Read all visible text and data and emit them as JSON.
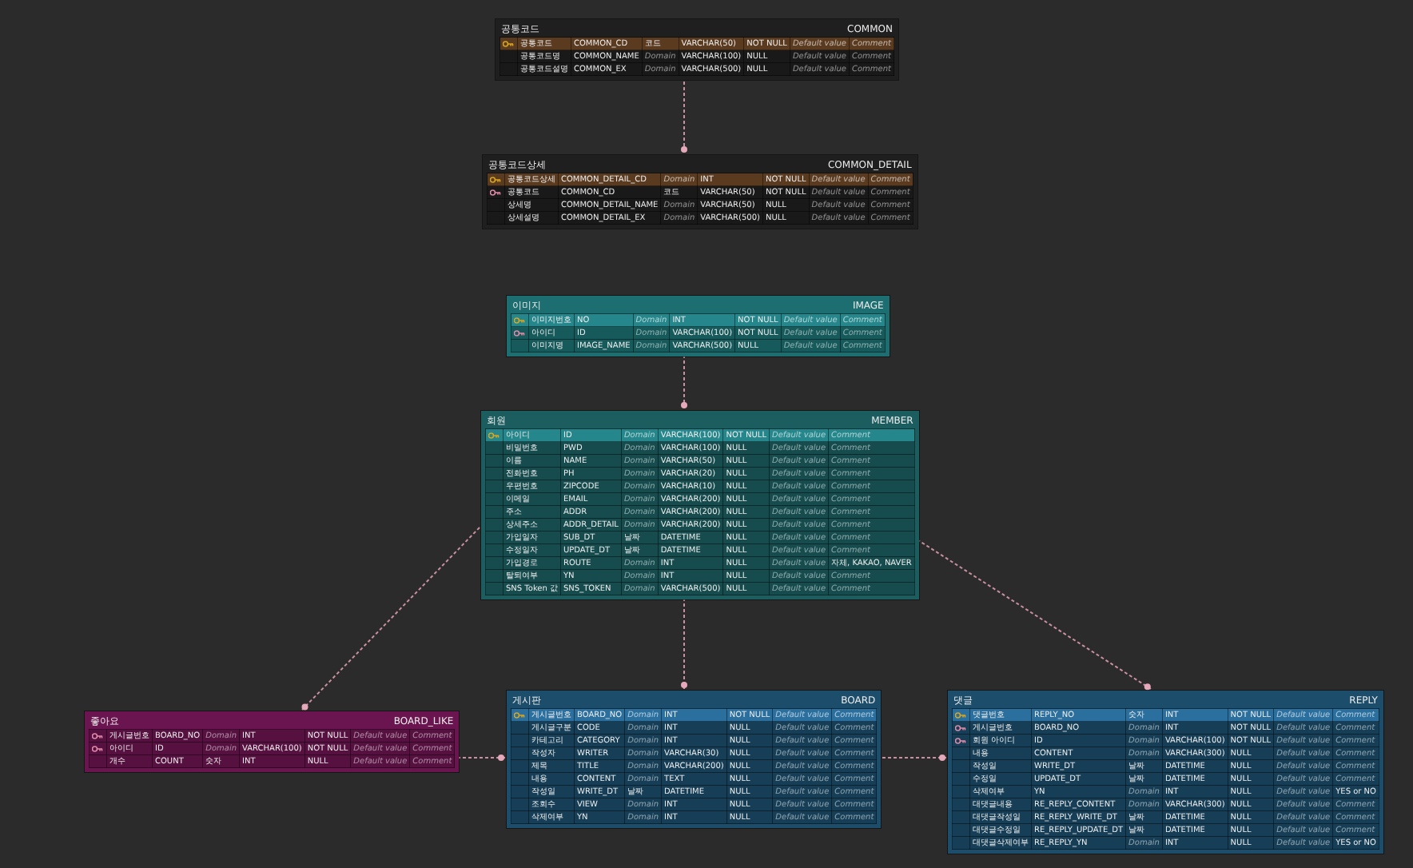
{
  "tables": [
    {
      "title": "공통코드",
      "name": "COMMON",
      "color": "#1f1f1f",
      "rows": [
        {
          "kind": "primary-key",
          "highlighted": true,
          "cells": [
            "공통코드",
            "COMMON_CD",
            "코드",
            "VARCHAR(50)",
            "NOT NULL",
            "Default value",
            "Comment"
          ],
          "hints": [
            false,
            false,
            false,
            false,
            false,
            true,
            true
          ]
        },
        {
          "kind": "plain",
          "highlighted": false,
          "cells": [
            "공통코드명",
            "COMMON_NAME",
            "Domain",
            "VARCHAR(100)",
            "NULL",
            "Default value",
            "Comment"
          ],
          "hints": [
            false,
            false,
            true,
            false,
            false,
            true,
            true
          ]
        },
        {
          "kind": "plain",
          "highlighted": false,
          "cells": [
            "공통코드설명",
            "COMMON_EX",
            "Domain",
            "VARCHAR(500)",
            "NULL",
            "Default value",
            "Comment"
          ],
          "hints": [
            false,
            false,
            true,
            false,
            false,
            true,
            true
          ]
        }
      ]
    },
    {
      "title": "공통코드상세",
      "name": "COMMON_DETAIL",
      "color": "#1f1f1f",
      "rows": [
        {
          "kind": "primary-key",
          "highlighted": true,
          "cells": [
            "공통코드상세",
            "COMMON_DETAIL_CD",
            "Domain",
            "INT",
            "NOT NULL",
            "Default value",
            "Comment"
          ],
          "hints": [
            false,
            false,
            true,
            false,
            false,
            true,
            true
          ]
        },
        {
          "kind": "foreign-key",
          "highlighted": false,
          "cells": [
            "공통코드",
            "COMMON_CD",
            "코드",
            "VARCHAR(50)",
            "NOT NULL",
            "Default value",
            "Comment"
          ],
          "hints": [
            false,
            false,
            false,
            false,
            false,
            true,
            true
          ]
        },
        {
          "kind": "plain",
          "highlighted": false,
          "cells": [
            "상세명",
            "COMMON_DETAIL_NAME",
            "Domain",
            "VARCHAR(50)",
            "NULL",
            "Default value",
            "Comment"
          ],
          "hints": [
            false,
            false,
            true,
            false,
            false,
            true,
            true
          ]
        },
        {
          "kind": "plain",
          "highlighted": false,
          "cells": [
            "상세설명",
            "COMMON_DETAIL_EX",
            "Domain",
            "VARCHAR(500)",
            "NULL",
            "Default value",
            "Comment"
          ],
          "hints": [
            false,
            false,
            true,
            false,
            false,
            true,
            true
          ]
        }
      ]
    },
    {
      "title": "이미지",
      "name": "IMAGE",
      "color": "#1d6e70",
      "rows": [
        {
          "kind": "primary-key",
          "highlighted": true,
          "cells": [
            "이미지번호",
            "NO",
            "Domain",
            "INT",
            "NOT NULL",
            "Default value",
            "Comment"
          ],
          "hints": [
            false,
            false,
            true,
            false,
            false,
            true,
            true
          ]
        },
        {
          "kind": "foreign-key",
          "highlighted": false,
          "cells": [
            "아이디",
            "ID",
            "Domain",
            "VARCHAR(100)",
            "NOT NULL",
            "Default value",
            "Comment"
          ],
          "hints": [
            false,
            false,
            true,
            false,
            false,
            true,
            true
          ]
        },
        {
          "kind": "plain",
          "highlighted": false,
          "cells": [
            "이미지명",
            "IMAGE_NAME",
            "Domain",
            "VARCHAR(500)",
            "NULL",
            "Default value",
            "Comment"
          ],
          "hints": [
            false,
            false,
            true,
            false,
            false,
            true,
            true
          ]
        }
      ]
    },
    {
      "title": "회원",
      "name": "MEMBER",
      "color": "#1c5d60",
      "rows": [
        {
          "kind": "primary-key",
          "highlighted": true,
          "cells": [
            "아이디",
            "ID",
            "Domain",
            "VARCHAR(100)",
            "NOT NULL",
            "Default value",
            "Comment"
          ],
          "hints": [
            false,
            false,
            true,
            false,
            false,
            true,
            true
          ]
        },
        {
          "kind": "plain",
          "highlighted": false,
          "cells": [
            "비밀번호",
            "PWD",
            "Domain",
            "VARCHAR(100)",
            "NULL",
            "Default value",
            "Comment"
          ],
          "hints": [
            false,
            false,
            true,
            false,
            false,
            true,
            true
          ]
        },
        {
          "kind": "plain",
          "highlighted": false,
          "cells": [
            "이름",
            "NAME",
            "Domain",
            "VARCHAR(50)",
            "NULL",
            "Default value",
            "Comment"
          ],
          "hints": [
            false,
            false,
            true,
            false,
            false,
            true,
            true
          ]
        },
        {
          "kind": "plain",
          "highlighted": false,
          "cells": [
            "전화번호",
            "PH",
            "Domain",
            "VARCHAR(20)",
            "NULL",
            "Default value",
            "Comment"
          ],
          "hints": [
            false,
            false,
            true,
            false,
            false,
            true,
            true
          ]
        },
        {
          "kind": "plain",
          "highlighted": false,
          "cells": [
            "우편번호",
            "ZIPCODE",
            "Domain",
            "VARCHAR(10)",
            "NULL",
            "Default value",
            "Comment"
          ],
          "hints": [
            false,
            false,
            true,
            false,
            false,
            true,
            true
          ]
        },
        {
          "kind": "plain",
          "highlighted": false,
          "cells": [
            "이메일",
            "EMAIL",
            "Domain",
            "VARCHAR(200)",
            "NULL",
            "Default value",
            "Comment"
          ],
          "hints": [
            false,
            false,
            true,
            false,
            false,
            true,
            true
          ]
        },
        {
          "kind": "plain",
          "highlighted": false,
          "cells": [
            "주소",
            "ADDR",
            "Domain",
            "VARCHAR(200)",
            "NULL",
            "Default value",
            "Comment"
          ],
          "hints": [
            false,
            false,
            true,
            false,
            false,
            true,
            true
          ]
        },
        {
          "kind": "plain",
          "highlighted": false,
          "cells": [
            "상세주소",
            "ADDR_DETAIL",
            "Domain",
            "VARCHAR(200)",
            "NULL",
            "Default value",
            "Comment"
          ],
          "hints": [
            false,
            false,
            true,
            false,
            false,
            true,
            true
          ]
        },
        {
          "kind": "plain",
          "highlighted": false,
          "cells": [
            "가입일자",
            "SUB_DT",
            "날짜",
            "DATETIME",
            "NULL",
            "Default value",
            "Comment"
          ],
          "hints": [
            false,
            false,
            false,
            false,
            false,
            true,
            true
          ]
        },
        {
          "kind": "plain",
          "highlighted": false,
          "cells": [
            "수정일자",
            "UPDATE_DT",
            "날짜",
            "DATETIME",
            "NULL",
            "Default value",
            "Comment"
          ],
          "hints": [
            false,
            false,
            false,
            false,
            false,
            true,
            true
          ]
        },
        {
          "kind": "plain",
          "highlighted": false,
          "cells": [
            "가입경로",
            "ROUTE",
            "Domain",
            "INT",
            "NULL",
            "Default value",
            "자체, KAKAO, NAVER"
          ],
          "hints": [
            false,
            false,
            true,
            false,
            false,
            true,
            false
          ]
        },
        {
          "kind": "plain",
          "highlighted": false,
          "cells": [
            "탈퇴여부",
            "YN",
            "Domain",
            "INT",
            "NULL",
            "Default value",
            "Comment"
          ],
          "hints": [
            false,
            false,
            true,
            false,
            false,
            true,
            true
          ]
        },
        {
          "kind": "plain",
          "highlighted": false,
          "cells": [
            "SNS Token 값",
            "SNS_TOKEN",
            "Domain",
            "VARCHAR(500)",
            "NULL",
            "Default value",
            "Comment"
          ],
          "hints": [
            false,
            false,
            true,
            false,
            false,
            true,
            true
          ]
        }
      ]
    },
    {
      "title": "좋아요",
      "name": "BOARD_LIKE",
      "color": "#6b1550",
      "rows": [
        {
          "kind": "foreign-key",
          "highlighted": false,
          "cells": [
            "게시글번호",
            "BOARD_NO",
            "Domain",
            "INT",
            "NOT NULL",
            "Default value",
            "Comment"
          ],
          "hints": [
            false,
            false,
            true,
            false,
            false,
            true,
            true
          ]
        },
        {
          "kind": "foreign-key",
          "highlighted": false,
          "cells": [
            "아이디",
            "ID",
            "Domain",
            "VARCHAR(100)",
            "NOT NULL",
            "Default value",
            "Comment"
          ],
          "hints": [
            false,
            false,
            true,
            false,
            false,
            true,
            true
          ]
        },
        {
          "kind": "plain",
          "highlighted": false,
          "cells": [
            "개수",
            "COUNT",
            "숫자",
            "INT",
            "NULL",
            "Default value",
            "Comment"
          ],
          "hints": [
            false,
            false,
            false,
            false,
            false,
            true,
            true
          ]
        }
      ]
    },
    {
      "title": "게시판",
      "name": "BOARD",
      "color": "#1c4d6b",
      "rows": [
        {
          "kind": "primary-key",
          "highlighted": true,
          "cells": [
            "게시글번호",
            "BOARD_NO",
            "Domain",
            "INT",
            "NOT NULL",
            "Default value",
            "Comment"
          ],
          "hints": [
            false,
            false,
            true,
            false,
            false,
            true,
            true
          ]
        },
        {
          "kind": "plain",
          "highlighted": false,
          "cells": [
            "게시글구분",
            "CODE",
            "Domain",
            "INT",
            "NULL",
            "Default value",
            "Comment"
          ],
          "hints": [
            false,
            false,
            true,
            false,
            false,
            true,
            true
          ]
        },
        {
          "kind": "plain",
          "highlighted": false,
          "cells": [
            "카테고리",
            "CATEGORY",
            "Domain",
            "INT",
            "NULL",
            "Default value",
            "Comment"
          ],
          "hints": [
            false,
            false,
            true,
            false,
            false,
            true,
            true
          ]
        },
        {
          "kind": "plain",
          "highlighted": false,
          "cells": [
            "작성자",
            "WRITER",
            "Domain",
            "VARCHAR(30)",
            "NULL",
            "Default value",
            "Comment"
          ],
          "hints": [
            false,
            false,
            true,
            false,
            false,
            true,
            true
          ]
        },
        {
          "kind": "plain",
          "highlighted": false,
          "cells": [
            "제목",
            "TITLE",
            "Domain",
            "VARCHAR(200)",
            "NULL",
            "Default value",
            "Comment"
          ],
          "hints": [
            false,
            false,
            true,
            false,
            false,
            true,
            true
          ]
        },
        {
          "kind": "plain",
          "highlighted": false,
          "cells": [
            "내용",
            "CONTENT",
            "Domain",
            "TEXT",
            "NULL",
            "Default value",
            "Comment"
          ],
          "hints": [
            false,
            false,
            true,
            false,
            false,
            true,
            true
          ]
        },
        {
          "kind": "plain",
          "highlighted": false,
          "cells": [
            "작성일",
            "WRITE_DT",
            "날짜",
            "DATETIME",
            "NULL",
            "Default value",
            "Comment"
          ],
          "hints": [
            false,
            false,
            false,
            false,
            false,
            true,
            true
          ]
        },
        {
          "kind": "plain",
          "highlighted": false,
          "cells": [
            "조회수",
            "VIEW",
            "Domain",
            "INT",
            "NULL",
            "Default value",
            "Comment"
          ],
          "hints": [
            false,
            false,
            true,
            false,
            false,
            true,
            true
          ]
        },
        {
          "kind": "plain",
          "highlighted": false,
          "cells": [
            "삭제여부",
            "YN",
            "Domain",
            "INT",
            "NULL",
            "Default value",
            "Comment"
          ],
          "hints": [
            false,
            false,
            true,
            false,
            false,
            true,
            true
          ]
        }
      ]
    },
    {
      "title": "댓글",
      "name": "REPLY",
      "color": "#1c4d6b",
      "rows": [
        {
          "kind": "primary-key",
          "highlighted": true,
          "cells": [
            "댓글번호",
            "REPLY_NO",
            "숫자",
            "INT",
            "NOT NULL",
            "Default value",
            "Comment"
          ],
          "hints": [
            false,
            false,
            false,
            false,
            false,
            true,
            true
          ]
        },
        {
          "kind": "foreign-key",
          "highlighted": false,
          "cells": [
            "게시글번호",
            "BOARD_NO",
            "Domain",
            "INT",
            "NOT NULL",
            "Default value",
            "Comment"
          ],
          "hints": [
            false,
            false,
            true,
            false,
            false,
            true,
            true
          ]
        },
        {
          "kind": "foreign-key",
          "highlighted": false,
          "cells": [
            "회원 아이디",
            "ID",
            "Domain",
            "VARCHAR(100)",
            "NOT NULL",
            "Default value",
            "Comment"
          ],
          "hints": [
            false,
            false,
            true,
            false,
            false,
            true,
            true
          ]
        },
        {
          "kind": "plain",
          "highlighted": false,
          "cells": [
            "내용",
            "CONTENT",
            "Domain",
            "VARCHAR(300)",
            "NULL",
            "Default value",
            "Comment"
          ],
          "hints": [
            false,
            false,
            true,
            false,
            false,
            true,
            true
          ]
        },
        {
          "kind": "plain",
          "highlighted": false,
          "cells": [
            "작성일",
            "WRITE_DT",
            "날짜",
            "DATETIME",
            "NULL",
            "Default value",
            "Comment"
          ],
          "hints": [
            false,
            false,
            false,
            false,
            false,
            true,
            true
          ]
        },
        {
          "kind": "plain",
          "highlighted": false,
          "cells": [
            "수정일",
            "UPDATE_DT",
            "날짜",
            "DATETIME",
            "NULL",
            "Default value",
            "Comment"
          ],
          "hints": [
            false,
            false,
            false,
            false,
            false,
            true,
            true
          ]
        },
        {
          "kind": "plain",
          "highlighted": false,
          "cells": [
            "삭제여부",
            "YN",
            "Domain",
            "INT",
            "NULL",
            "Default value",
            "YES or NO"
          ],
          "hints": [
            false,
            false,
            true,
            false,
            false,
            true,
            false
          ]
        },
        {
          "kind": "plain",
          "highlighted": false,
          "cells": [
            "대댓글내용",
            "RE_REPLY_CONTENT",
            "Domain",
            "VARCHAR(300)",
            "NULL",
            "Default value",
            "Comment"
          ],
          "hints": [
            false,
            false,
            true,
            false,
            false,
            true,
            true
          ]
        },
        {
          "kind": "plain",
          "highlighted": false,
          "cells": [
            "대댓글작성일",
            "RE_REPLY_WRITE_DT",
            "날짜",
            "DATETIME",
            "NULL",
            "Default value",
            "Comment"
          ],
          "hints": [
            false,
            false,
            false,
            false,
            false,
            true,
            true
          ]
        },
        {
          "kind": "plain",
          "highlighted": false,
          "cells": [
            "대댓글수정일",
            "RE_REPLY_UPDATE_DT",
            "날짜",
            "DATETIME",
            "NULL",
            "Default value",
            "Comment"
          ],
          "hints": [
            false,
            false,
            false,
            false,
            false,
            true,
            true
          ]
        },
        {
          "kind": "plain",
          "highlighted": false,
          "cells": [
            "대댓글삭제여부",
            "RE_REPLY_YN",
            "Domain",
            "INT",
            "NULL",
            "Default value",
            "YES or NO"
          ],
          "hints": [
            false,
            false,
            true,
            false,
            false,
            true,
            false
          ]
        }
      ]
    }
  ]
}
